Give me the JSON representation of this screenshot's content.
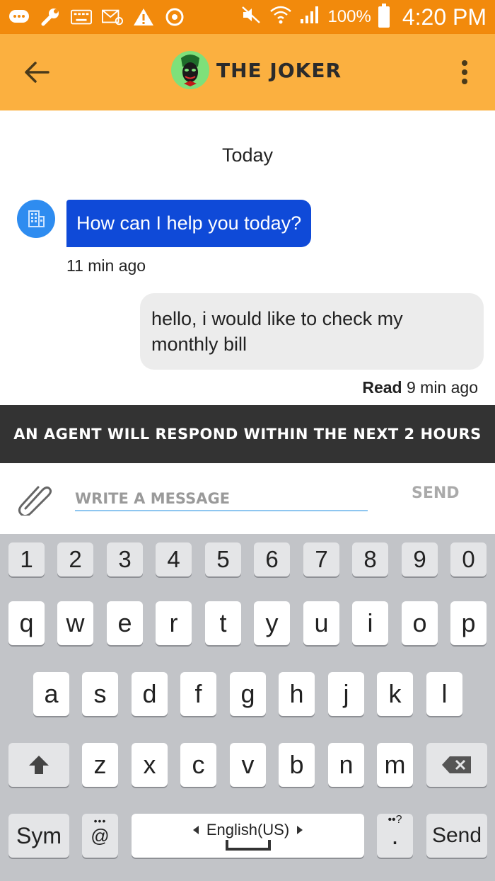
{
  "status_bar": {
    "battery": "100%",
    "time": "4:20 PM"
  },
  "app_bar": {
    "title": "THE JOKER"
  },
  "chat": {
    "date_separator": "Today",
    "messages": [
      {
        "direction": "incoming",
        "text": "How can I help you today?",
        "timestamp": "11 min ago"
      },
      {
        "direction": "outgoing",
        "text": "hello, i would like to check my monthly bill",
        "read_label": "Read",
        "timestamp": "9 min ago"
      }
    ]
  },
  "banner": {
    "text": "AN AGENT WILL RESPOND WITHIN THE NEXT  2 HOURS"
  },
  "composer": {
    "placeholder": "WRITE A MESSAGE",
    "send_label": "SEND"
  },
  "keyboard": {
    "number_row": [
      "1",
      "2",
      "3",
      "4",
      "5",
      "6",
      "7",
      "8",
      "9",
      "0"
    ],
    "row1": [
      "q",
      "w",
      "e",
      "r",
      "t",
      "y",
      "u",
      "i",
      "o",
      "p"
    ],
    "row2": [
      "a",
      "s",
      "d",
      "f",
      "g",
      "h",
      "j",
      "k",
      "l"
    ],
    "row3": [
      "z",
      "x",
      "c",
      "v",
      "b",
      "n",
      "m"
    ],
    "sym_label": "Sym",
    "at_label": "@",
    "space_label": "English(US)",
    "period_label": ".",
    "send_label": "Send"
  },
  "colors": {
    "status_bar": "#f28a0c",
    "app_bar": "#fbb040",
    "incoming_bubble": "#0f4ad8",
    "outgoing_bubble": "#ececec",
    "banner": "#333333",
    "keyboard_bg": "#c2c4c8"
  }
}
